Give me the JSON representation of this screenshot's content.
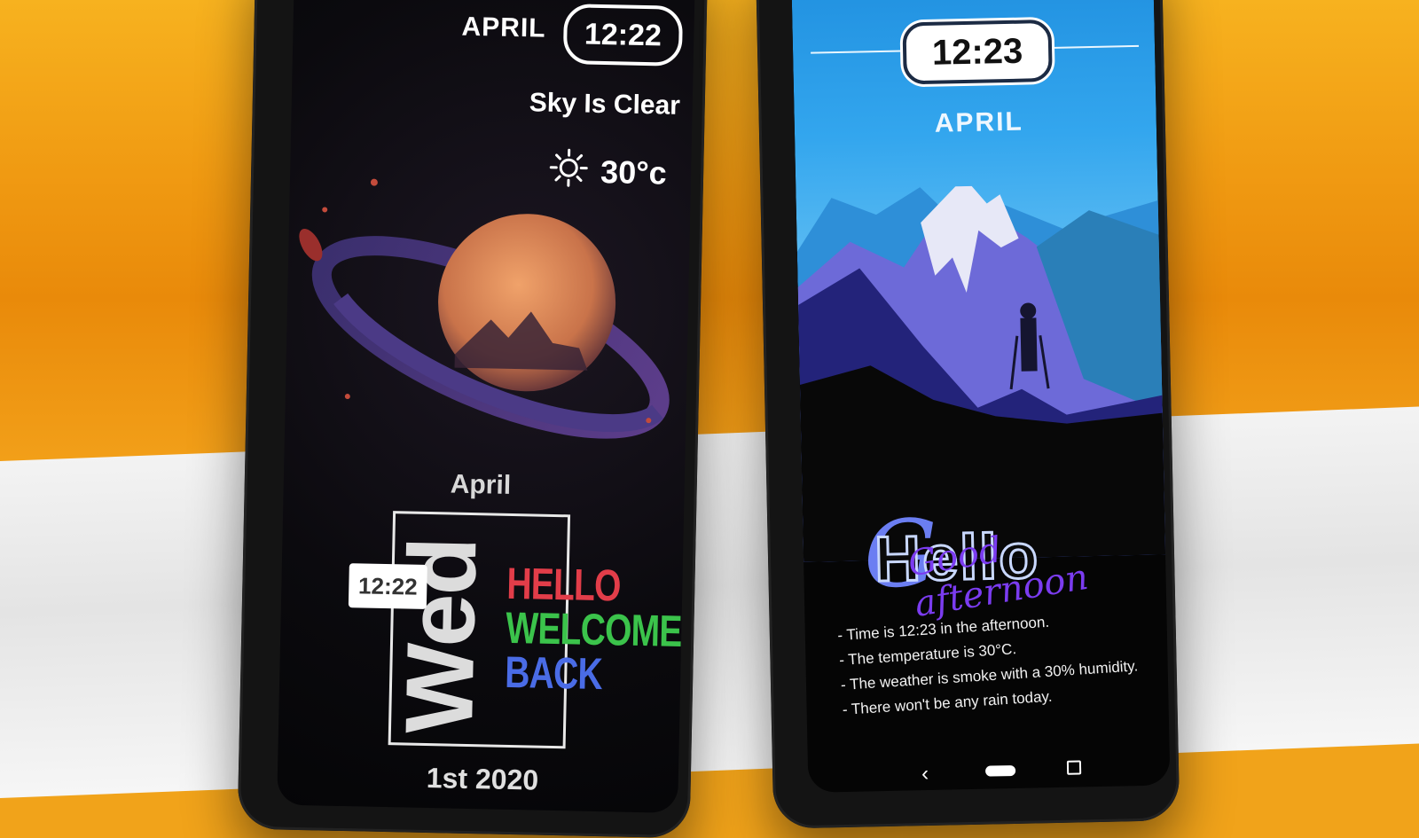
{
  "left_phone": {
    "top_month": "APRIL",
    "top_time": "12:22",
    "weather_status": "Sky Is Clear",
    "temperature": "30°c",
    "weather_icon": "sun-icon",
    "month_label": "April",
    "day_label": "Wed",
    "time_box": "12:22",
    "greeting_line1": "HELLO",
    "greeting_line2": "WELCOME",
    "greeting_line3": "BACK",
    "date_line": "1st 2020",
    "colors": {
      "hello": "#e23d49",
      "welcome": "#3bc34b",
      "back": "#4a6ce6"
    }
  },
  "right_phone": {
    "time": "12:23",
    "month": "APRIL",
    "greeting_main": "Hello",
    "greeting_script": "Good afternoon",
    "info_lines": [
      "- Time is 12:23 in the afternoon.",
      "- The temperature is 30°C.",
      "- The weather is smoke with a 30% humidity.",
      "- There won't be any rain today."
    ],
    "nav": {
      "back_icon": "chevron-left-icon",
      "home_icon": "home-pill-icon",
      "recent_icon": "square-icon"
    }
  }
}
